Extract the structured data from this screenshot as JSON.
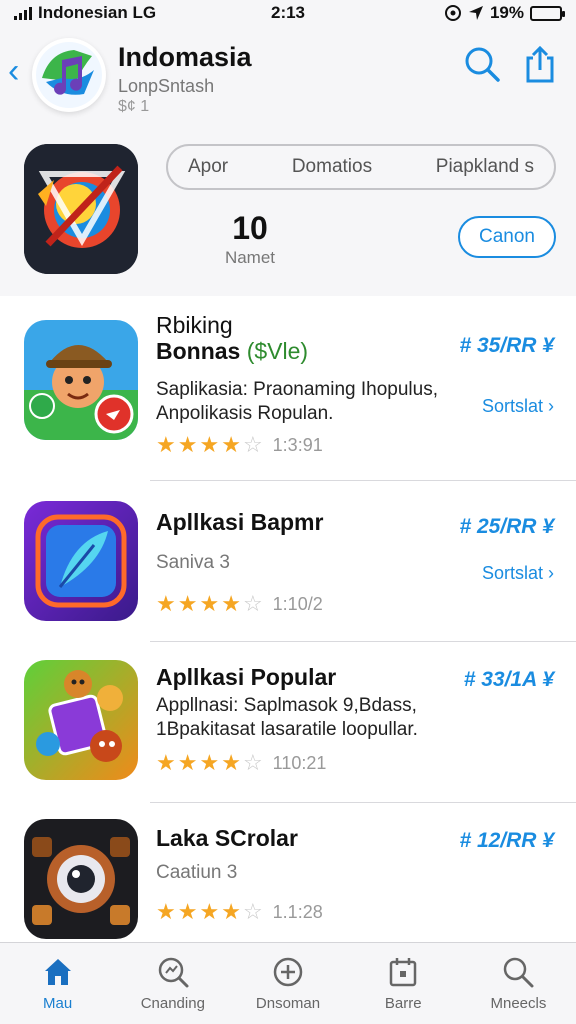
{
  "status": {
    "carrier": "Indonesian LG",
    "time": "2:13",
    "battery": "19%"
  },
  "header": {
    "title": "Indomasia",
    "subtitle": "LonpSntash",
    "subtitle2": "$¢ 1"
  },
  "featured": {
    "segments": [
      "Apor",
      "Domatios",
      "Piapkland s"
    ],
    "count": "10",
    "count_label": "Namet",
    "button_label": "Canon"
  },
  "apps": [
    {
      "title": "Rbiking",
      "title2": "Bonnas",
      "title_accent": "($Vle)",
      "desc": [
        "Saplikasia: Praonaming Ihopulus,",
        "Anpolikasis Ropulan."
      ],
      "rank": "# 35/RR ¥",
      "action": "Sortslat ›",
      "rating_count": "1:3:91",
      "stars": 4
    },
    {
      "title": "Apllkasi Bapmr",
      "desc": [
        "Saniva 3"
      ],
      "rank": "# 25/RR ¥",
      "action": "Sortslat ›",
      "rating_count": "1:10/2",
      "stars": 4
    },
    {
      "title": "Apllkasi Popular",
      "desc": [
        "Appllnasi: Saplmasok 9,Bdass,",
        "1Bpakitasat lasaratile loopullar."
      ],
      "rank": "# 33/1A ¥",
      "action": "",
      "rating_count": "110:21",
      "stars": 4
    },
    {
      "title": "Laka SCrolar",
      "desc": [
        "Caatiun 3"
      ],
      "rank": "# 12/RR ¥",
      "action": "",
      "rating_count": "1.1:28",
      "stars": 4
    }
  ],
  "tabs": [
    {
      "label": "Mau",
      "icon": "home-icon"
    },
    {
      "label": "Cnanding",
      "icon": "trending-search-icon"
    },
    {
      "label": "Dnsoman",
      "icon": "plus-circle-icon"
    },
    {
      "label": "Barre",
      "icon": "calendar-icon"
    },
    {
      "label": "Mneecls",
      "icon": "search-icon"
    }
  ],
  "colors": {
    "accent": "#1a8ce0",
    "star": "#f5a623",
    "accent_green": "#2e8b2e"
  }
}
